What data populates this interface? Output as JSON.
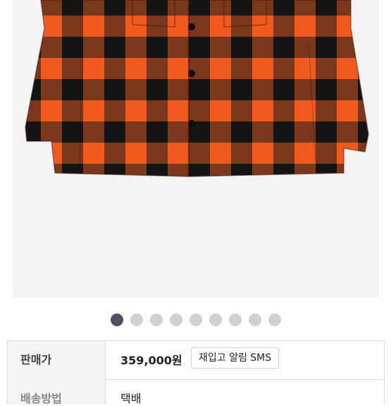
{
  "product_image": {
    "alt": "orange buffalo check shirt",
    "colors": {
      "orange": "#f05a1e",
      "black": "#141414",
      "rust": "#9a3f22"
    }
  },
  "carousel": {
    "total": 9,
    "active_index": 0,
    "active_color": "#4b5064",
    "inactive_color": "#d0d0d0"
  },
  "info": {
    "price_label": "판매가",
    "price_value": "359,000원",
    "restock_button": "재입고 알림 SMS",
    "shipping_label": "배송방법",
    "shipping_value": "택배"
  }
}
